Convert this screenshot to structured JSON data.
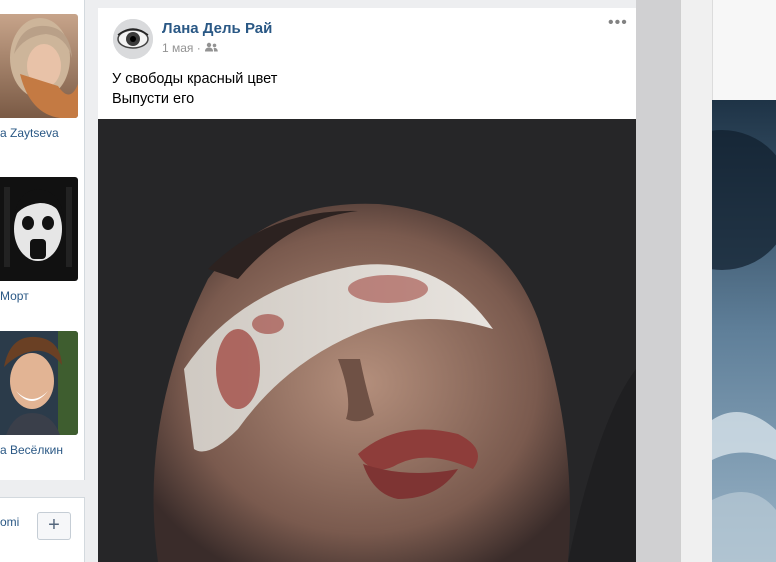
{
  "friends": [
    {
      "name": "a Zaytseva"
    },
    {
      "name": "Морт"
    },
    {
      "name": "а Весёлкин"
    }
  ],
  "mini_card": {
    "text": "omi",
    "add_label": "+"
  },
  "post": {
    "author": "Лана Дель Рай",
    "date": "1 мая ·",
    "audience_icon": "friends-icon",
    "more_label": "•••",
    "text_lines": [
      "У свободы красный цвет",
      "Выпусти его"
    ]
  },
  "colors": {
    "link": "#2a5885",
    "page_bg": "#edeef0",
    "meta": "#939393"
  }
}
